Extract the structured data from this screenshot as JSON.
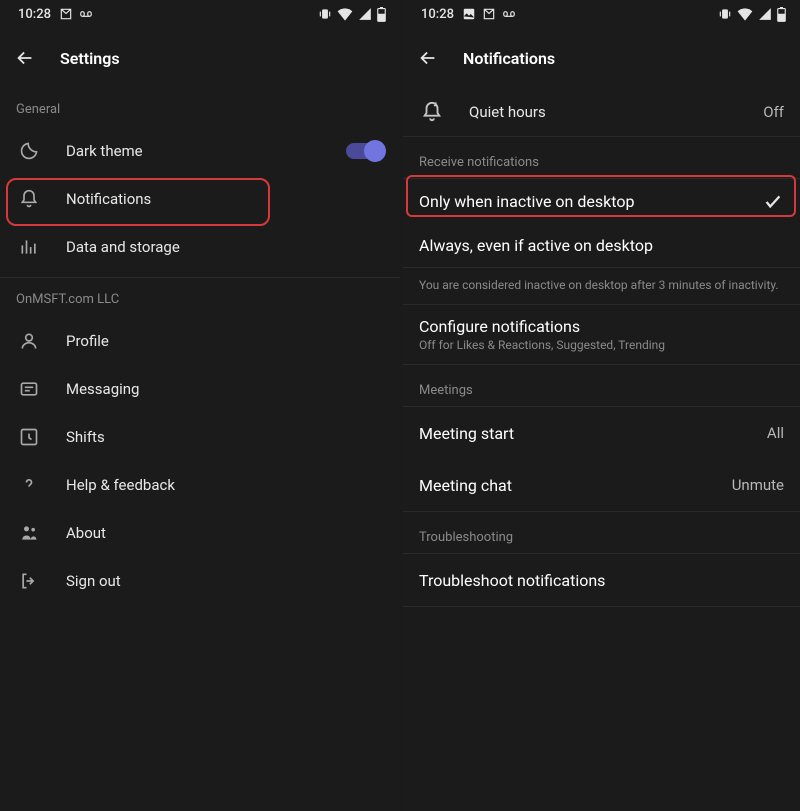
{
  "status": {
    "time": "10:28"
  },
  "left": {
    "title": "Settings",
    "section_general": "General",
    "dark_theme": "Dark theme",
    "notifications": "Notifications",
    "data_storage": "Data and storage",
    "section_org": "OnMSFT.com LLC",
    "profile": "Profile",
    "messaging": "Messaging",
    "shifts": "Shifts",
    "help": "Help & feedback",
    "about": "About",
    "signout": "Sign out"
  },
  "right": {
    "title": "Notifications",
    "quiet_hours": "Quiet hours",
    "quiet_hours_value": "Off",
    "section_receive": "Receive notifications",
    "only_inactive": "Only when inactive on desktop",
    "always": "Always, even if active on desktop",
    "inactive_desc": "You are considered inactive on desktop after 3 minutes of inactivity.",
    "configure": "Configure notifications",
    "configure_sub": "Off for Likes & Reactions, Suggested, Trending",
    "section_meetings": "Meetings",
    "meeting_start": "Meeting start",
    "meeting_start_value": "All",
    "meeting_chat": "Meeting chat",
    "meeting_chat_value": "Unmute",
    "section_troubleshooting": "Troubleshooting",
    "troubleshoot": "Troubleshoot notifications"
  }
}
